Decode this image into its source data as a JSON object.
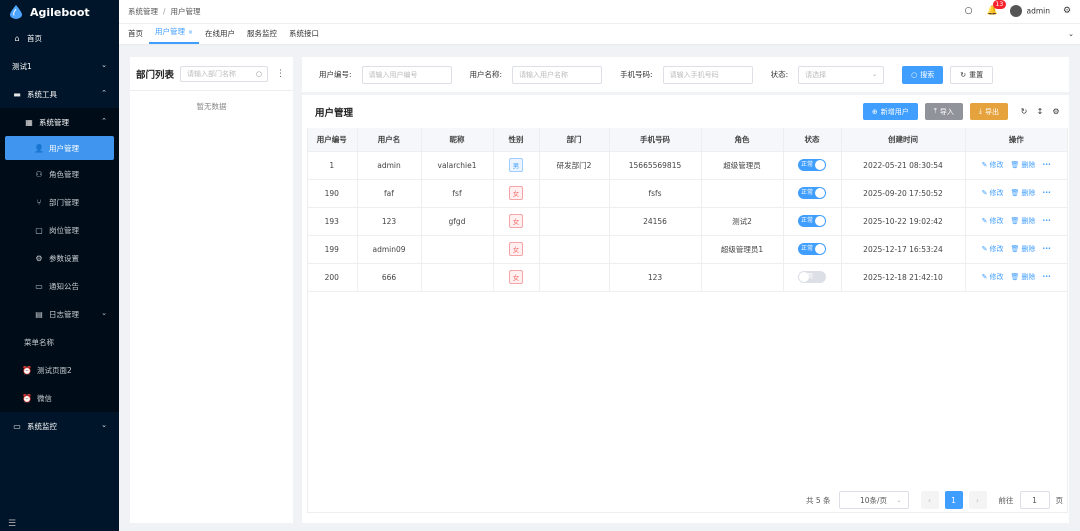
{
  "app": {
    "name": "Agileboot"
  },
  "sidebar": {
    "items": [
      {
        "label": "首页",
        "icon": "home-icon"
      },
      {
        "label": "测试1",
        "icon": "none"
      },
      {
        "label": "系统工具",
        "icon": "toolbox-icon"
      },
      {
        "label": "系统管理",
        "icon": "grid-icon"
      },
      {
        "label": "用户管理",
        "icon": "user-icon"
      },
      {
        "label": "角色管理",
        "icon": "user-group-icon"
      },
      {
        "label": "部门管理",
        "icon": "tree-icon"
      },
      {
        "label": "岗位管理",
        "icon": "post-icon"
      },
      {
        "label": "参数设置",
        "icon": "settings-icon"
      },
      {
        "label": "通知公告",
        "icon": "notice-icon"
      },
      {
        "label": "日志管理",
        "icon": "log-icon"
      },
      {
        "label": "菜单名称",
        "icon": "none"
      },
      {
        "label": "测试页面2",
        "icon": "clock-icon"
      },
      {
        "label": "微信",
        "icon": "clock-icon"
      },
      {
        "label": "系统监控",
        "icon": "monitor-icon"
      }
    ]
  },
  "header": {
    "breadcrumb": [
      "系统管理",
      "用户管理"
    ],
    "notification_count": "13",
    "username": "admin"
  },
  "tabs": [
    {
      "label": "首页"
    },
    {
      "label": "用户管理"
    },
    {
      "label": "在线用户"
    },
    {
      "label": "服务监控"
    },
    {
      "label": "系统接口"
    }
  ],
  "dept": {
    "title": "部门列表",
    "search_placeholder": "请输入部门名称",
    "empty": "暂无数据"
  },
  "filters": {
    "user_id_label": "用户编号:",
    "user_id_placeholder": "请输入用户编号",
    "username_label": "用户名称:",
    "username_placeholder": "请输入用户名称",
    "phone_label": "手机号码:",
    "phone_placeholder": "请输入手机号码",
    "status_label": "状态:",
    "status_placeholder": "请选择",
    "search_btn": "搜索",
    "reset_btn": "重置"
  },
  "main": {
    "title": "用户管理",
    "add_btn": "新增用户",
    "import_btn": "导入",
    "export_btn": "导出"
  },
  "table": {
    "columns": [
      "用户编号",
      "用户名",
      "昵称",
      "性别",
      "部门",
      "手机号码",
      "角色",
      "状态",
      "创建时间",
      "操作"
    ],
    "rows": [
      {
        "id": "1",
        "username": "admin",
        "nickname": "valarchie1",
        "sex": "男",
        "dept": "研发部门2",
        "phone": "15665569815",
        "role": "超级管理员",
        "status": "正常",
        "status_on": true,
        "created": "2022-05-21 08:30:54"
      },
      {
        "id": "190",
        "username": "faf",
        "nickname": "fsf",
        "sex": "女",
        "dept": "",
        "phone": "fsfs",
        "role": "",
        "status": "正常",
        "status_on": true,
        "created": "2025-09-20 17:50:52"
      },
      {
        "id": "193",
        "username": "123",
        "nickname": "gfgd",
        "sex": "女",
        "dept": "",
        "phone": "24156",
        "role": "测试2",
        "status": "正常",
        "status_on": true,
        "created": "2025-10-22 19:02:42"
      },
      {
        "id": "199",
        "username": "admin09",
        "nickname": "",
        "sex": "女",
        "dept": "",
        "phone": "",
        "role": "超级管理员1",
        "status": "正常",
        "status_on": true,
        "created": "2025-12-17 16:53:24"
      },
      {
        "id": "200",
        "username": "666",
        "nickname": "",
        "sex": "女",
        "dept": "",
        "phone": "123",
        "role": "",
        "status": "停用",
        "status_on": false,
        "created": "2025-12-18 21:42:10"
      }
    ],
    "edit_label": "修改",
    "delete_label": "删除",
    "more_label": "···"
  },
  "pagination": {
    "total": "共 5 条",
    "page_size": "10条/页",
    "current": "1",
    "goto_label": "前往",
    "goto_value": "1",
    "page_unit": "页"
  },
  "colors": {
    "primary": "#409eff",
    "sidebar_bg": "#001529",
    "warning": "#e6a23c",
    "info": "#909399"
  }
}
